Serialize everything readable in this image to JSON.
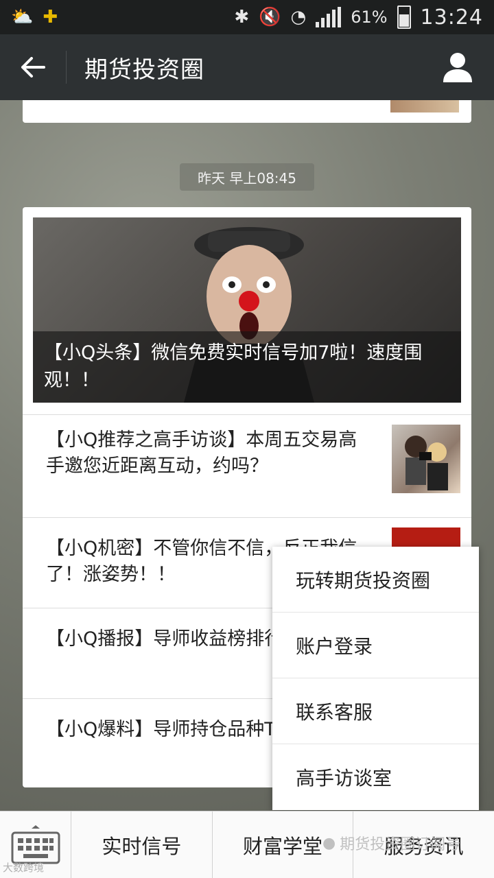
{
  "status_bar": {
    "battery": "61%",
    "time": "13:24"
  },
  "title_bar": {
    "title": "期货投资圈"
  },
  "chat": {
    "timestamp": "昨天 早上08:45",
    "hero_caption": "【小Q头条】微信免费实时信号加7啦！速度围观！！",
    "articles": [
      {
        "title": "【小Q推荐之高手访谈】本周五交易高手邀您近距离互动，约吗？"
      },
      {
        "title": "【小Q机密】不管你信不信，反正我信了！涨姿势！！"
      },
      {
        "title": "【小Q播报】导师收益榜排行TOP3"
      },
      {
        "title": "【小Q爆料】导师持仓品种TOP5"
      }
    ]
  },
  "popup_menu": {
    "items": [
      {
        "label": "玩转期货投资圈"
      },
      {
        "label": "账户登录"
      },
      {
        "label": "联系客服"
      },
      {
        "label": "高手访谈室"
      }
    ]
  },
  "bottom_menu": {
    "items": [
      {
        "label": "实时信号"
      },
      {
        "label": "财富学堂"
      },
      {
        "label": "服务资讯"
      }
    ]
  },
  "watermark": {
    "text": "期货投资圈订阅号",
    "corner_text": "大数跨境"
  }
}
